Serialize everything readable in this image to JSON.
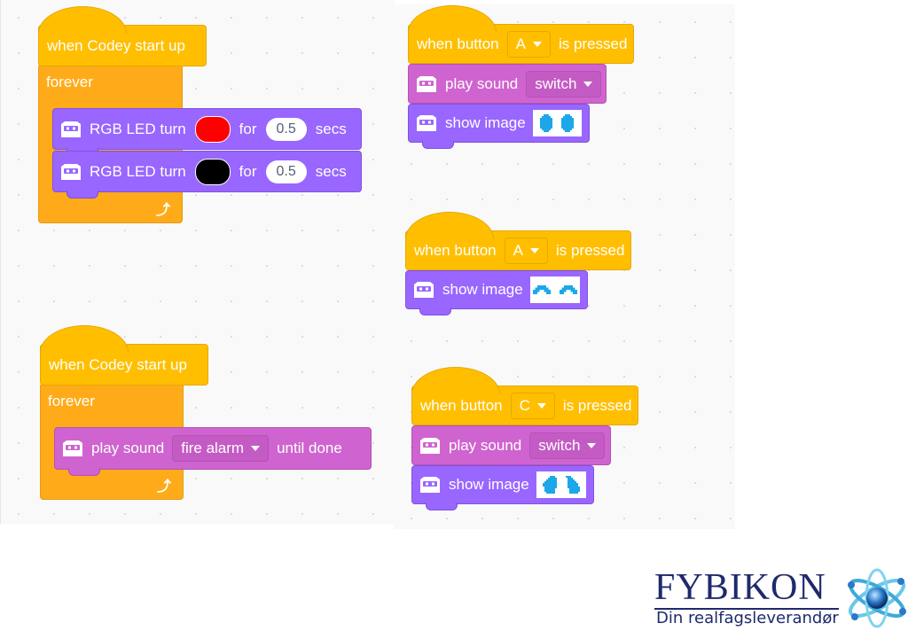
{
  "scripts": [
    {
      "hat": {
        "label": "when Codey start up"
      },
      "loop": {
        "label": "forever"
      },
      "blocks": [
        {
          "label": "RGB LED turn",
          "color_value": "#ff0000",
          "for_label": "for",
          "duration": "0.5",
          "unit": "secs"
        },
        {
          "label": "RGB LED turn",
          "color_value": "#000000",
          "for_label": "for",
          "duration": "0.5",
          "unit": "secs"
        }
      ]
    },
    {
      "hat": {
        "label": "when Codey start up"
      },
      "loop": {
        "label": "forever"
      },
      "blocks": [
        {
          "label": "play sound",
          "sound": "fire alarm",
          "suffix": "until done"
        }
      ]
    },
    {
      "hat": {
        "prefix": "when button",
        "button": "A",
        "suffix": "is pressed"
      },
      "blocks": [
        {
          "label": "play sound",
          "sound": "switch"
        },
        {
          "label": "show image",
          "image": "tall-eyes"
        }
      ]
    },
    {
      "hat": {
        "prefix": "when button",
        "button": "A",
        "suffix": "is pressed"
      },
      "blocks": [
        {
          "label": "show image",
          "image": "happy-eyes"
        }
      ]
    },
    {
      "hat": {
        "prefix": "when button",
        "button": "C",
        "suffix": "is pressed"
      },
      "blocks": [
        {
          "label": "play sound",
          "sound": "switch"
        },
        {
          "label": "show image",
          "image": "slanted-eyes"
        }
      ]
    }
  ],
  "icons": {
    "block_icon": "codey-robot-icon",
    "loop_icon": "loop-arrow-icon",
    "dropdown_icon": "caret-down-icon"
  },
  "colors": {
    "event": "#ffbf00",
    "control": "#ffab19",
    "looks": "#9966ff",
    "sound": "#cf63cf",
    "image_pixels": "#1ca8e8",
    "brand": "#1f2a6b"
  },
  "logo": {
    "brand": "FYBIKON",
    "tagline": "Din realfagsleverandør"
  }
}
